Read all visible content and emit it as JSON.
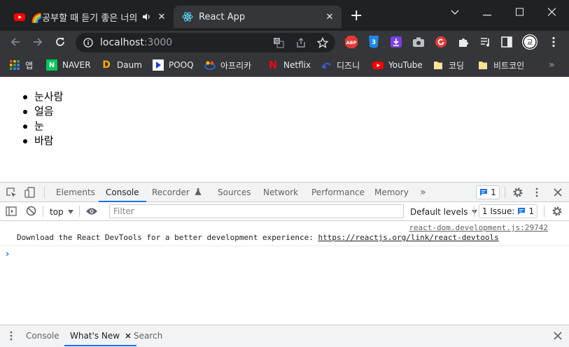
{
  "browser": {
    "tabs": [
      {
        "title": "🌈공부할 때 듣기 좋은 너의 이름은",
        "audio_icon": "speaker-icon",
        "close": "✕",
        "favicon": "youtube-icon"
      },
      {
        "title": "React App",
        "close": "✕",
        "favicon": "react-icon"
      }
    ],
    "new_tab": "+",
    "window_controls": {
      "minimize": "—",
      "maximize": "☐",
      "close": "✕",
      "dropdown": "⌄"
    },
    "address": {
      "host": "localhost",
      "port": ":3000"
    },
    "extensions": [
      "translate-icon",
      "share-icon",
      "star-icon",
      "abp-icon",
      "css-icon",
      "download-icon",
      "camera-icon",
      "refresh-ext-icon",
      "puzzle-icon",
      "media-icon",
      "sidepanel-icon",
      "profile-icon",
      "menu-icon"
    ],
    "abp_label": "ABP",
    "profile_label": "교",
    "bookmarks": [
      {
        "label": "앱",
        "icon": "apps-grid-icon"
      },
      {
        "label": "NAVER",
        "icon": "naver-icon",
        "glyph": "N"
      },
      {
        "label": "Daum",
        "icon": "daum-icon",
        "glyph": "D"
      },
      {
        "label": "POOQ",
        "icon": "pooq-icon"
      },
      {
        "label": "아프리카",
        "icon": "afreeca-icon"
      },
      {
        "label": "Netflix",
        "icon": "netflix-icon",
        "glyph": "N"
      },
      {
        "label": "디즈니",
        "icon": "disney-icon"
      },
      {
        "label": "YouTube",
        "icon": "youtube-icon"
      },
      {
        "label": "코딩",
        "icon": "folder-icon"
      },
      {
        "label": "비트코인",
        "icon": "folder-icon"
      }
    ],
    "bookmarks_overflow": "»"
  },
  "page": {
    "items": [
      "눈사람",
      "얼음",
      "눈",
      "바람"
    ]
  },
  "devtools": {
    "tabs": [
      "Elements",
      "Console",
      "Recorder",
      "Sources",
      "Network",
      "Performance",
      "Memory"
    ],
    "active_tab": "Console",
    "more": "»",
    "message_count": "1",
    "context": "top",
    "filter_placeholder": "Filter",
    "levels": "Default levels",
    "issues": "1 Issue:",
    "issues_count": "1",
    "console_message": {
      "source": "react-dom.development.js:29742",
      "text": "Download the React DevTools for a better development experience: ",
      "link": "https://reactjs.org/link/react-devtools"
    },
    "prompt": "›",
    "drawer_tabs": [
      "Console",
      "What's New",
      "Search"
    ],
    "drawer_active": "What's New"
  },
  "colors": {
    "chrome_dark": "#202124",
    "toolbar": "#35363a",
    "accent": "#1a73e8",
    "youtube_red": "#ff0000",
    "naver_green": "#03c75a"
  }
}
